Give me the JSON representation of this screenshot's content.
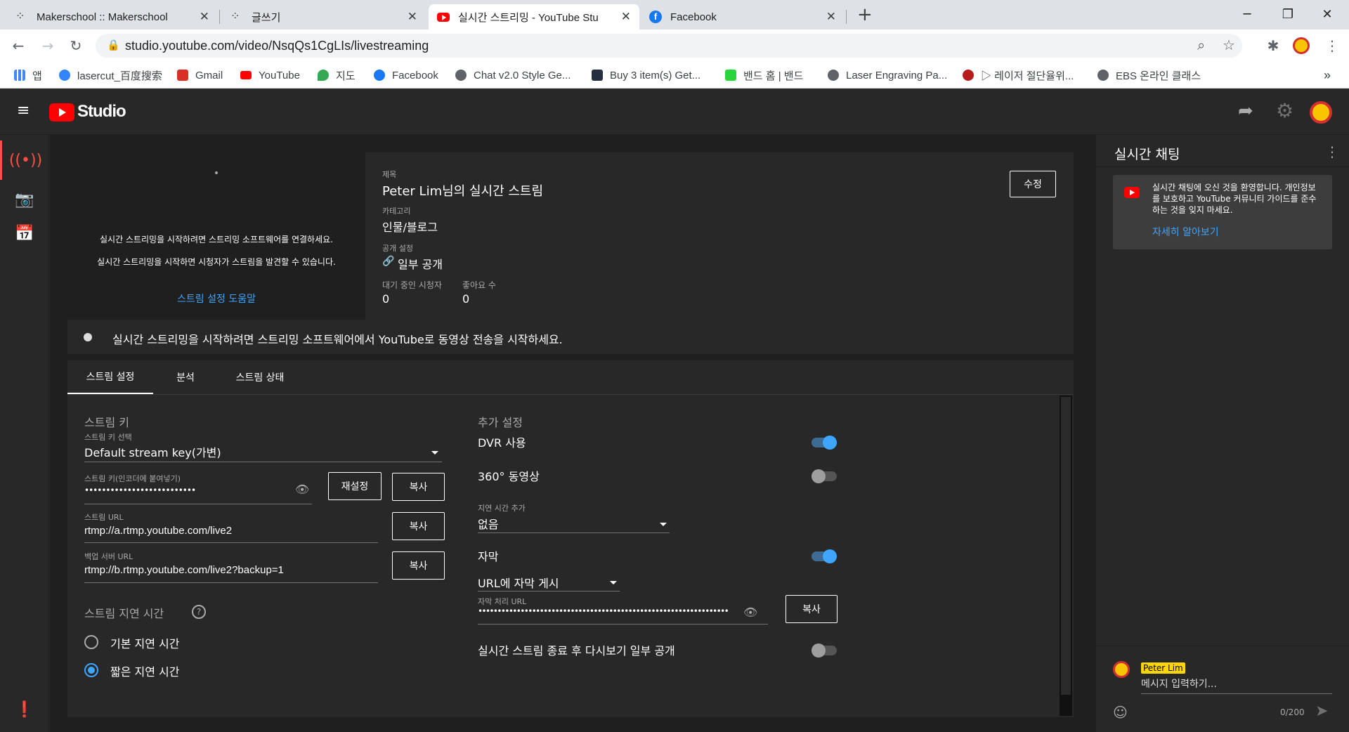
{
  "browser": {
    "tabs": [
      {
        "title": "Makerschool :: Makerschool",
        "close": "✕"
      },
      {
        "title": "글쓰기",
        "close": "✕"
      },
      {
        "title": "실시간 스트리밍 - YouTube Stu",
        "close": "✕"
      },
      {
        "title": "Facebook",
        "close": "✕"
      }
    ],
    "new_tab": "+",
    "url": "studio.youtube.com/video/NsqQs1CgLIs/livestreaming",
    "bookmarks": [
      {
        "label": "앱",
        "color": "#ea4335"
      },
      {
        "label": "lasercut_百度搜索",
        "color": "#3385ff"
      },
      {
        "label": "Gmail",
        "color": "#d93025"
      },
      {
        "label": "YouTube",
        "color": "#ff0000"
      },
      {
        "label": "지도",
        "color": "#34a853"
      },
      {
        "label": "Facebook",
        "color": "#1877f2"
      },
      {
        "label": "Chat v2.0 Style Ge...",
        "color": "#5f6368"
      },
      {
        "label": "Buy 3 item(s) Get...",
        "color": "#232f3e"
      },
      {
        "label": "밴드 홈 | 밴드",
        "color": "#2ad53b"
      },
      {
        "label": "Laser Engraving Pa...",
        "color": "#5f6368"
      },
      {
        "label": "▷ 레이저 절단율위...",
        "color": "#b71c1c"
      },
      {
        "label": "EBS 온라인 클래스",
        "color": "#5f6368"
      }
    ],
    "more": "»"
  },
  "studio": {
    "logo_text": "Studio",
    "preview": {
      "dot": "•",
      "line1": "실시간 스트리밍을 시작하려면 스트리밍 소프트웨어를 연결하세요.",
      "line2": "실시간 스트리밍을 시작하면 시청자가 스트림을 발견할 수 있습니다.",
      "help_link": "스트림 설정 도움말"
    },
    "info": {
      "title_label": "제목",
      "title": "Peter Lim님의 실시간 스트림",
      "category_label": "카테고리",
      "category": "인물/블로그",
      "visibility_label": "공개 설정",
      "visibility": "일부 공개",
      "viewers_label": "대기 중인 시청자",
      "viewers": "0",
      "likes_label": "좋아요 수",
      "likes": "0",
      "edit_button": "수정"
    },
    "status_banner": "실시간 스트리밍을 시작하려면 스트리밍 소프트웨어에서 YouTube로 동영상 전송을 시작하세요.",
    "tabs": [
      "스트림 설정",
      "분석",
      "스트림 상태"
    ],
    "stream_key": {
      "heading": "스트림 키",
      "select_label": "스트림 키 선택",
      "select_value": "Default stream key(가변)",
      "key_label": "스트림 키(인코더에 붙여넣기)",
      "key_value": "••••••••••••••••••••••••••",
      "reset_button": "재설정",
      "copy_button": "복사",
      "url_label": "스트림 URL",
      "url_value": "rtmp://a.rtmp.youtube.com/live2",
      "backup_label": "백업 서버 URL",
      "backup_value": "rtmp://b.rtmp.youtube.com/live2?backup=1"
    },
    "latency": {
      "heading": "스트림 지연 시간",
      "help": "?",
      "options": [
        "기본 지연 시간",
        "짧은 지연 시간"
      ],
      "selected": 1
    },
    "additional": {
      "heading": "추가 설정",
      "dvr_label": "DVR 사용",
      "dvr_on": true,
      "vr_label": "360° 동영상",
      "vr_on": false,
      "delay_label": "지연 시간 추가",
      "delay_value": "없음",
      "captions_label": "자막",
      "captions_on": true,
      "caption_mode": "URL에 자막 게시",
      "caption_url_label": "자막 처리 URL",
      "caption_url_value": "•••••••••••••••••••••••••••••••••••••••••••••••••••••••••••••••••",
      "copy_button": "복사",
      "replay_label": "실시간 스트림 종료 후 다시보기 일부 공개",
      "replay_on": false
    }
  },
  "chat": {
    "title": "실시간 채팅",
    "menu": "⋮",
    "welcome": "실시간 채팅에 오신 것을 환영합니다. 개인정보를 보호하고 YouTube 커뮤니티 가이드를 준수하는 것을 잊지 마세요.",
    "learn_more": "자세히 알아보기",
    "user": "Peter Lim",
    "placeholder": "메시지 입력하기...",
    "counter": "0/200"
  },
  "colors": {
    "accent": "#3ea6ff",
    "youtube_red": "#ff0000",
    "background": "#1f1f1f",
    "panel": "#282828"
  }
}
